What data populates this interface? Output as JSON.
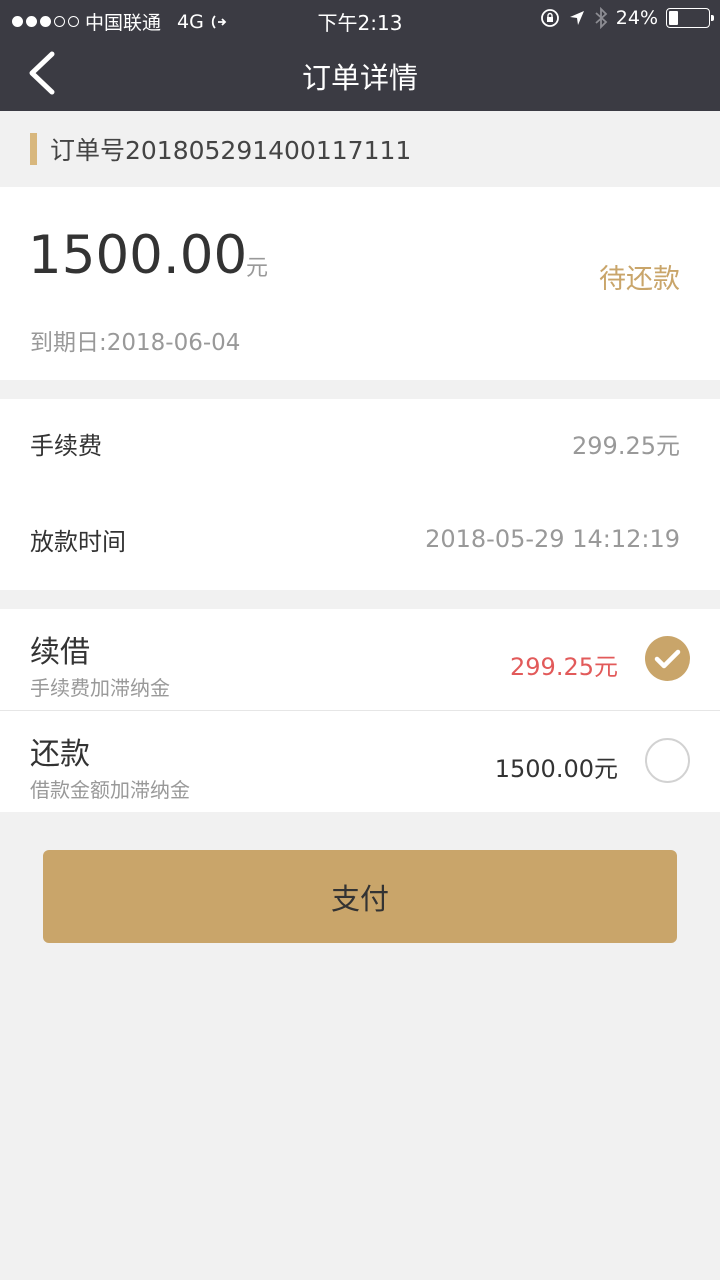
{
  "status_bar": {
    "carrier": "中国联通",
    "network": "4G",
    "time": "下午2:13",
    "battery": "24%",
    "battery_level": 0.24
  },
  "nav": {
    "title": "订单详情"
  },
  "order": {
    "number_label": "订单号201805291400117111"
  },
  "amount": {
    "value": "1500.00",
    "unit": "元",
    "status": "待还款",
    "due_label": "到期日:2018-06-04"
  },
  "info": [
    {
      "label": "手续费",
      "value": "299.25元"
    },
    {
      "label": "放款时间",
      "value": "2018-05-29 14:12:19"
    }
  ],
  "options": [
    {
      "title": "续借",
      "subtitle": "手续费加滞纳金",
      "price": "299.25元",
      "price_color": "#e25a5a",
      "selected": true
    },
    {
      "title": "还款",
      "subtitle": "借款金额加滞纳金",
      "price": "1500.00元",
      "price_color": "#333333",
      "selected": false
    }
  ],
  "pay_button": {
    "label": "支付"
  },
  "colors": {
    "header_bg": "#3b3b43",
    "accent_gold": "#c9a56a",
    "alert_red": "#e25a5a"
  }
}
